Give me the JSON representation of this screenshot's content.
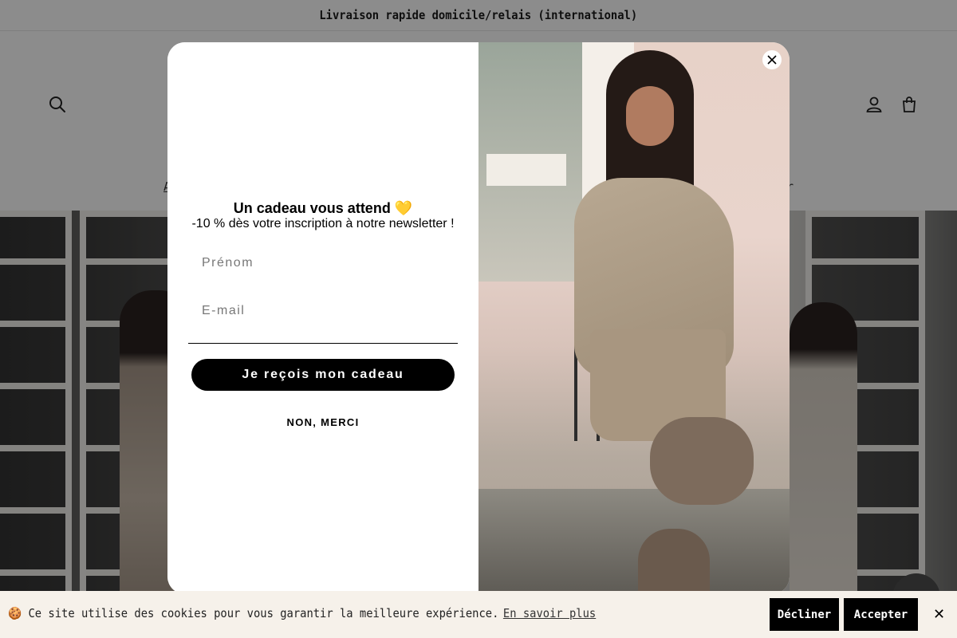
{
  "announcement": "Livraison rapide domicile/relais (international)",
  "header": {
    "nav_items": [
      {
        "label": "A"
      },
      {
        "label": "r"
      }
    ]
  },
  "popup": {
    "title": "Un cadeau vous attend 💛",
    "subtitle": "-10 % dès votre inscription à notre newsletter !",
    "first_name_placeholder": "Prénom",
    "email_placeholder": "E-mail",
    "cta_label": "Je reçois mon cadeau",
    "decline_label": "NON, MERCI"
  },
  "cookie_bar": {
    "text": "🍪 Ce site utilise des cookies pour vous garantir la meilleure expérience.",
    "link_label": "En savoir plus",
    "decline_label": "Décliner",
    "accept_label": "Accepter",
    "close_label": "✕"
  },
  "colors": {
    "overlay": "rgba(0,0,0,0.45)",
    "button": "#000000",
    "cookie_bg": "#f6f1ea"
  }
}
